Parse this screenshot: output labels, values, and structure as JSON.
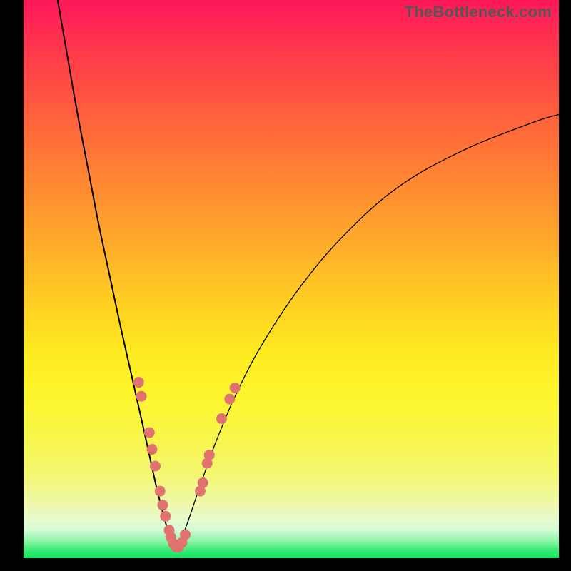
{
  "watermark": "TheBottleneck.com",
  "colors": {
    "black": "#000000",
    "dot": "#e0736f",
    "gradient_top": "#ff175a",
    "gradient_bottom": "#14e560"
  },
  "chart_data": {
    "type": "line",
    "title": "",
    "xlabel": "",
    "ylabel": "",
    "xlim": [
      0,
      100
    ],
    "ylim": [
      0,
      100
    ],
    "grid": false,
    "legend": false,
    "series": [
      {
        "name": "left-curve",
        "x": [
          6,
          8,
          10,
          12,
          14,
          16,
          18,
          20,
          22,
          23.5,
          25,
          26.5,
          27.5,
          28.2
        ],
        "y": [
          102,
          91,
          80,
          70,
          60,
          51,
          42,
          33.5,
          25,
          18.5,
          12,
          6.5,
          3,
          1.5
        ]
      },
      {
        "name": "right-curve",
        "x": [
          28.2,
          29,
          30.5,
          33,
          36,
          40,
          45,
          52,
          60,
          70,
          82,
          95,
          100
        ],
        "y": [
          1.5,
          2.5,
          6,
          13,
          21,
          30,
          39,
          49,
          58,
          66.5,
          73,
          78,
          79.5
        ]
      }
    ],
    "scatter_points": [
      {
        "x": 21.5,
        "y": 31.5,
        "series": "left"
      },
      {
        "x": 22.0,
        "y": 29.0,
        "series": "left"
      },
      {
        "x": 23.5,
        "y": 22.5,
        "series": "left"
      },
      {
        "x": 24.0,
        "y": 19.5,
        "series": "left"
      },
      {
        "x": 24.6,
        "y": 16.5,
        "series": "left"
      },
      {
        "x": 25.5,
        "y": 12.0,
        "series": "left"
      },
      {
        "x": 26.0,
        "y": 9.5,
        "series": "left"
      },
      {
        "x": 26.5,
        "y": 7.5,
        "series": "left"
      },
      {
        "x": 27.2,
        "y": 5.0,
        "series": "left"
      },
      {
        "x": 27.5,
        "y": 3.8,
        "series": "left"
      },
      {
        "x": 28.0,
        "y": 2.6,
        "series": "left"
      },
      {
        "x": 28.5,
        "y": 2.0,
        "series": "left"
      },
      {
        "x": 29.0,
        "y": 2.0,
        "series": "left"
      },
      {
        "x": 29.6,
        "y": 2.8,
        "series": "right"
      },
      {
        "x": 30.2,
        "y": 4.2,
        "series": "right"
      },
      {
        "x": 33.0,
        "y": 12.0,
        "series": "right"
      },
      {
        "x": 33.5,
        "y": 13.5,
        "series": "right"
      },
      {
        "x": 34.3,
        "y": 17.0,
        "series": "right"
      },
      {
        "x": 34.7,
        "y": 18.5,
        "series": "right"
      },
      {
        "x": 37.0,
        "y": 25.0,
        "series": "right"
      },
      {
        "x": 38.5,
        "y": 28.5,
        "series": "right"
      },
      {
        "x": 39.5,
        "y": 30.5,
        "series": "right"
      }
    ],
    "dot_radius_px": 7.5,
    "notes": "x and y are in percent of the plot area (0–100). y=0 is bottom, y=100 is top."
  }
}
